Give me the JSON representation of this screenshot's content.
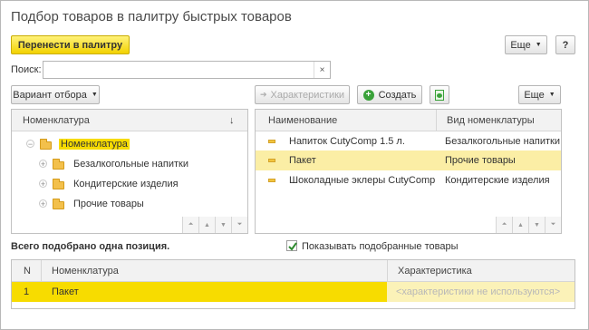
{
  "window": {
    "title": "Подбор товаров в палитру быстрых товаров"
  },
  "toolbar": {
    "transfer_label": "Перенести в палитру",
    "more_label": "Еще",
    "help_label": "?"
  },
  "search": {
    "label": "Поиск:",
    "value": "",
    "clear": "×"
  },
  "filter": {
    "variant_label": "Вариант отбора"
  },
  "tree": {
    "header": "Номенклатура",
    "sort_icon": "↓",
    "root": "Номенклатура",
    "items": [
      "Безалкогольные напитки",
      "Кондитерские изделия",
      "Прочие товары"
    ]
  },
  "right_toolbar": {
    "characteristics_label": "Характеристики",
    "create_label": "Создать",
    "more_label": "Еще"
  },
  "product_table": {
    "columns": [
      "Наименование",
      "Вид номенклатуры"
    ],
    "rows": [
      {
        "name": "Напиток CutyComp 1.5 л.",
        "kind": "Безалкогольные напитки"
      },
      {
        "name": "Пакет",
        "kind": "Прочие товары"
      },
      {
        "name": "Шоколадные эклеры CutyComp",
        "kind": "Кондитерские изделия"
      }
    ]
  },
  "status": {
    "selected_count_text": "Всего подобрано одна позиция.",
    "show_selected_label": "Показывать подобранные товары",
    "show_selected_checked": true
  },
  "selected_table": {
    "columns": [
      "N",
      "Номенклатура",
      "Характеристика"
    ],
    "rows": [
      {
        "n": "1",
        "name": "Пакет",
        "characteristic": "<характеристики не используются>"
      }
    ]
  },
  "colors": {
    "accent_yellow": "#f7dc00",
    "selection": "#fbeea5",
    "create_green": "#3aa23a"
  }
}
